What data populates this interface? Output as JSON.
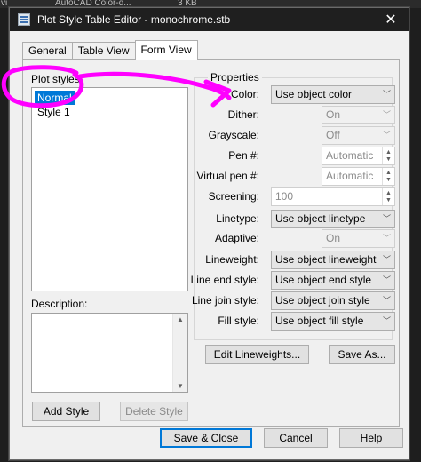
{
  "background": {
    "left_text": "vi",
    "mid_text": "AutoCAD Color-d...",
    "right_text": "3 KB"
  },
  "window": {
    "title": "Plot Style Table Editor - monochrome.stb",
    "close_glyph": "✕"
  },
  "tabs": [
    {
      "label": "General",
      "active": false
    },
    {
      "label": "Table View",
      "active": false
    },
    {
      "label": "Form View",
      "active": true
    }
  ],
  "plot_styles": {
    "label": "Plot styles:",
    "items": [
      {
        "label": "Normal",
        "selected": true
      },
      {
        "label": "Style 1",
        "selected": false
      }
    ]
  },
  "description": {
    "label": "Description:",
    "value": ""
  },
  "left_buttons": {
    "add": "Add Style",
    "delete": "Delete Style"
  },
  "properties": {
    "legend": "Properties",
    "color": {
      "label": "Color:",
      "value": "Use object color"
    },
    "dither": {
      "label": "Dither:",
      "value": "On"
    },
    "grayscale": {
      "label": "Grayscale:",
      "value": "Off"
    },
    "pen": {
      "label": "Pen #:",
      "value": "Automatic"
    },
    "virtual_pen": {
      "label": "Virtual pen #:",
      "value": "Automatic"
    },
    "screening": {
      "label": "Screening:",
      "value": "100"
    },
    "linetype": {
      "label": "Linetype:",
      "value": "Use object linetype"
    },
    "adaptive": {
      "label": "Adaptive:",
      "value": "On"
    },
    "lineweight": {
      "label": "Lineweight:",
      "value": "Use object lineweight"
    },
    "line_end_style": {
      "label": "Line end style:",
      "value": "Use object end style"
    },
    "line_join_style": {
      "label": "Line join style:",
      "value": "Use object join style"
    },
    "fill_style": {
      "label": "Fill style:",
      "value": "Use object fill style"
    }
  },
  "property_buttons": {
    "edit_lineweights": "Edit Lineweights...",
    "save_as": "Save As..."
  },
  "footer": {
    "save_close": "Save & Close",
    "cancel": "Cancel",
    "help": "Help"
  },
  "annotation_color": "#ff00ff",
  "accent_color": "#0078d7"
}
